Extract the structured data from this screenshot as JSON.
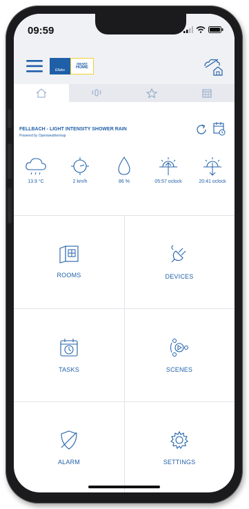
{
  "status_bar": {
    "time": "09:59"
  },
  "app": {
    "brand": {
      "logo_text": "Eltako",
      "badge_line1": "SMART",
      "badge_line2": "HOME"
    },
    "colors": {
      "accent": "#1f5fa8",
      "bar_bg": "#f0f1f4",
      "tab_bg": "#e7e9ee",
      "divider": "#dfe2e8"
    }
  },
  "tabs": [
    {
      "icon": "home-icon",
      "active": true
    },
    {
      "icon": "sensor-icon",
      "active": false
    },
    {
      "icon": "star-icon",
      "active": false
    },
    {
      "icon": "calendar-icon",
      "active": false
    }
  ],
  "weather": {
    "title": "FELLBACH - LIGHT INTENSITY SHOWER RAIN",
    "subtitle": "Powered by Openweathermap",
    "stats": [
      {
        "icon": "cloud-rain-icon",
        "value": "13.9 °C"
      },
      {
        "icon": "wind-icon",
        "value": "2 km/h"
      },
      {
        "icon": "humidity-drop-icon",
        "value": "86 %"
      },
      {
        "icon": "sunrise-icon",
        "value": "05:57 oclock"
      },
      {
        "icon": "sunset-icon",
        "value": "20:41 oclock"
      }
    ]
  },
  "menu": [
    {
      "label": "ROOMS",
      "icon": "rooms-icon"
    },
    {
      "label": "DEVICES",
      "icon": "plug-icon"
    },
    {
      "label": "TASKS",
      "icon": "task-clock-icon"
    },
    {
      "label": "SCENES",
      "icon": "scenes-icon"
    },
    {
      "label": "ALARM",
      "icon": "alarm-shield-icon"
    },
    {
      "label": "SETTINGS",
      "icon": "gear-icon"
    }
  ]
}
